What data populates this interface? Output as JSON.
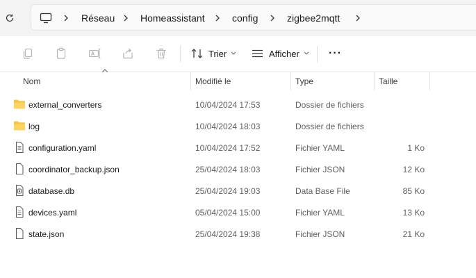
{
  "breadcrumb": {
    "items": [
      "Réseau",
      "Homeassistant",
      "config",
      "zigbee2mqtt"
    ]
  },
  "toolbar": {
    "sort_label": "Trier",
    "view_label": "Afficher",
    "more_label": "···"
  },
  "columns": {
    "name": "Nom",
    "modified": "Modifié le",
    "type": "Type",
    "size": "Taille"
  },
  "files": [
    {
      "name": "external_converters",
      "modified": "10/04/2024 17:53",
      "type": "Dossier de fichiers",
      "size": "",
      "icon": "folder-icon"
    },
    {
      "name": "log",
      "modified": "10/04/2024 18:03",
      "type": "Dossier de fichiers",
      "size": "",
      "icon": "folder-icon"
    },
    {
      "name": "configuration.yaml",
      "modified": "10/04/2024 17:52",
      "type": "Fichier YAML",
      "size": "1 Ko",
      "icon": "text-file-icon"
    },
    {
      "name": "coordinator_backup.json",
      "modified": "25/04/2024 18:03",
      "type": "Fichier JSON",
      "size": "12 Ko",
      "icon": "file-icon"
    },
    {
      "name": "database.db",
      "modified": "25/04/2024 19:03",
      "type": "Data Base File",
      "size": "85 Ko",
      "icon": "database-file-icon"
    },
    {
      "name": "devices.yaml",
      "modified": "05/04/2024 15:00",
      "type": "Fichier YAML",
      "size": "13 Ko",
      "icon": "text-file-icon"
    },
    {
      "name": "state.json",
      "modified": "25/04/2024 19:38",
      "type": "Fichier JSON",
      "size": "21 Ko",
      "icon": "file-icon"
    }
  ],
  "colors": {
    "folder": "#f8c43a",
    "accent": "#0067c0",
    "address_bg": "#f3f3f3"
  }
}
